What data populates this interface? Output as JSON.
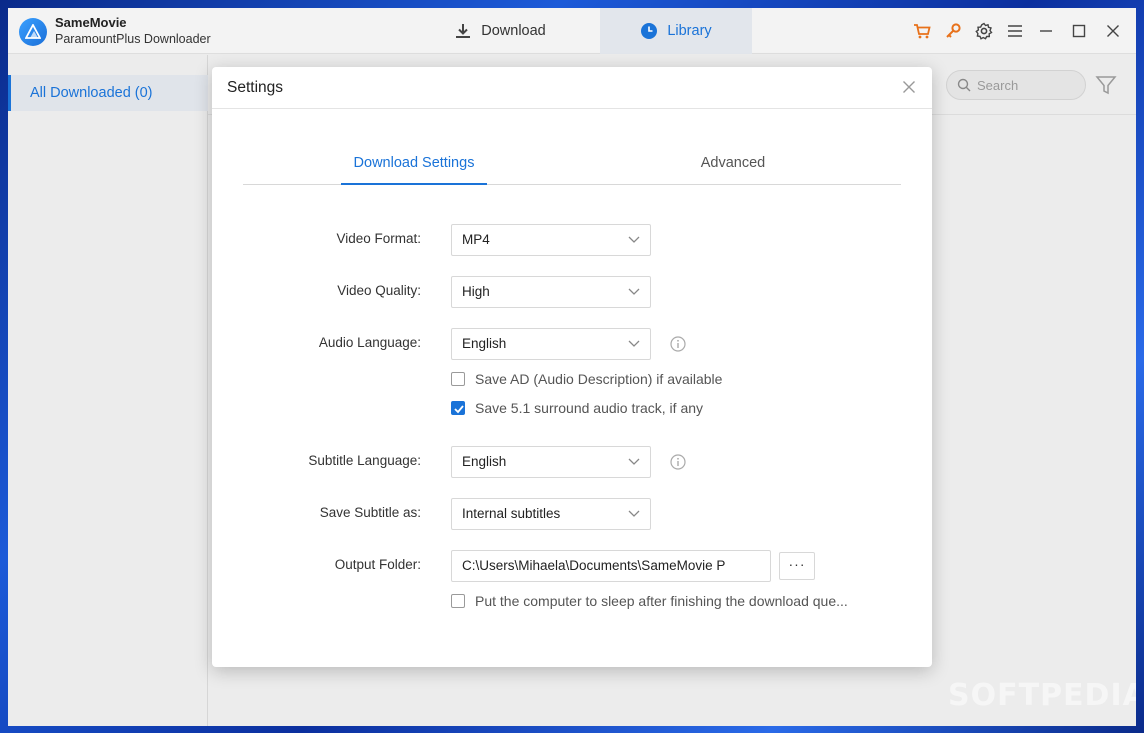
{
  "app": {
    "name": "SameMovie",
    "subtitle": "ParamountPlus Downloader"
  },
  "nav": {
    "download_label": "Download",
    "library_label": "Library"
  },
  "sidebar": {
    "items": [
      {
        "label": "All Downloaded (0)"
      }
    ]
  },
  "search": {
    "placeholder": "Search"
  },
  "dialog": {
    "title": "Settings",
    "tabs": [
      {
        "label": "Download Settings"
      },
      {
        "label": "Advanced"
      }
    ],
    "video_format": {
      "label": "Video Format:",
      "value": "MP4"
    },
    "video_quality": {
      "label": "Video Quality:",
      "value": "High"
    },
    "audio_language": {
      "label": "Audio Language:",
      "value": "English"
    },
    "save_ad": {
      "label": "Save AD (Audio Description) if available",
      "checked": false
    },
    "save_surround": {
      "label": "Save 5.1 surround audio track, if any",
      "checked": true
    },
    "subtitle_language": {
      "label": "Subtitle Language:",
      "value": "English"
    },
    "save_subtitle": {
      "label": "Save Subtitle as:",
      "value": "Internal subtitles"
    },
    "output_folder": {
      "label": "Output Folder:",
      "value": "C:\\Users\\Mihaela\\Documents\\SameMovie P",
      "browse_label": "···"
    },
    "sleep": {
      "label": "Put the computer to sleep after finishing the download que...",
      "checked": false
    }
  },
  "watermark": "SOFTPEDIA",
  "colors": {
    "accent": "#1a73d8",
    "cart": "#e8711a",
    "key": "#e8711a"
  }
}
